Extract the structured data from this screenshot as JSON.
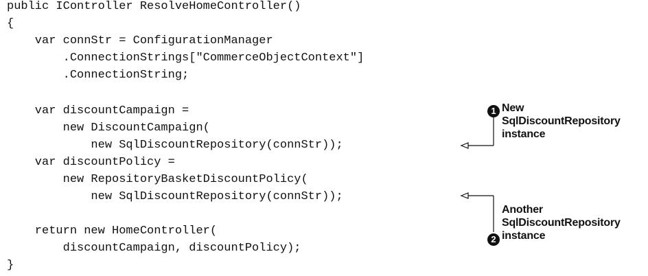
{
  "code": {
    "lines": [
      "public IController ResolveHomeController()",
      "{",
      "    var connStr = ConfigurationManager",
      "        .ConnectionStrings[\"CommerceObjectContext\"]",
      "        .ConnectionString;",
      "",
      "    var discountCampaign =",
      "        new DiscountCampaign(",
      "            new SqlDiscountRepository(connStr));",
      "    var discountPolicy =",
      "        new RepositoryBasketDiscountPolicy(",
      "            new SqlDiscountRepository(connStr));",
      "",
      "    return new HomeController(",
      "        discountCampaign, discountPolicy);",
      "}"
    ]
  },
  "annotations": [
    {
      "marker": "1",
      "lines": [
        "New",
        "SqlDiscountRepository",
        "instance"
      ]
    },
    {
      "marker": "2",
      "lines": [
        "Another",
        "SqlDiscountRepository",
        "instance"
      ]
    }
  ]
}
